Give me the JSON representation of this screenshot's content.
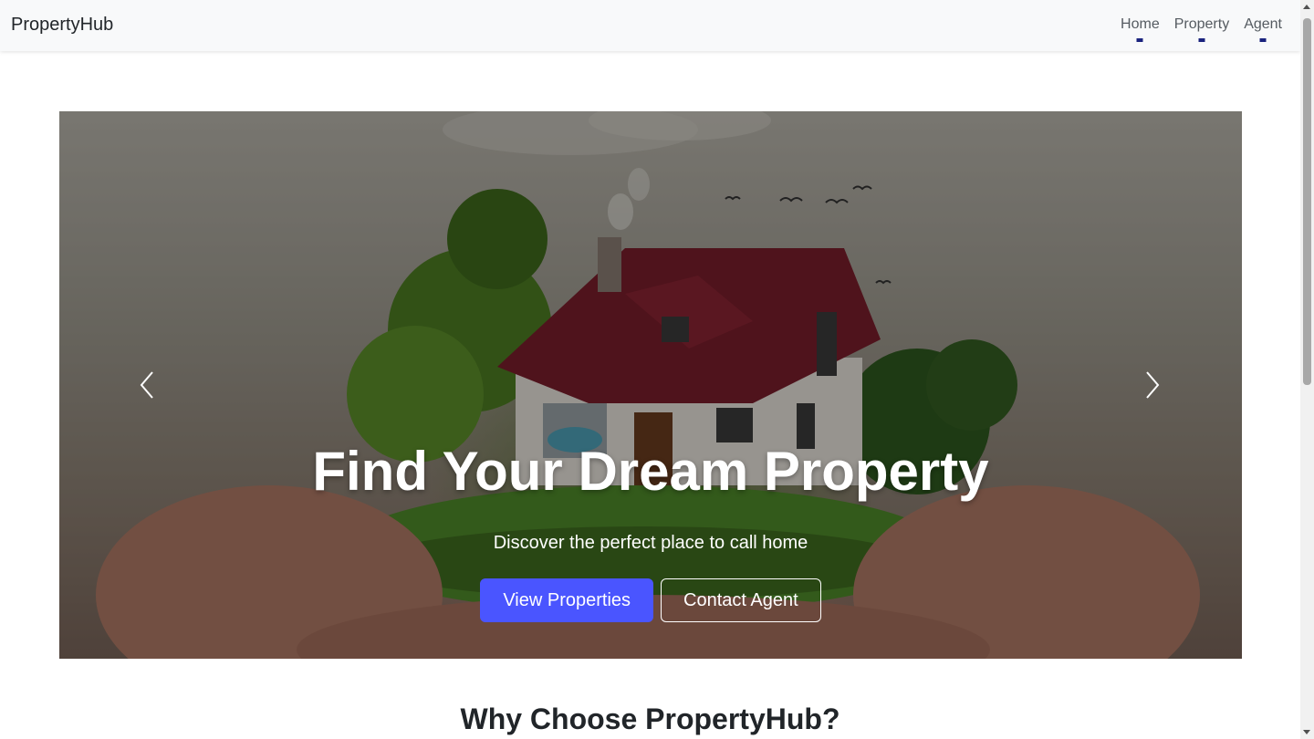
{
  "navbar": {
    "brand": "PropertyHub",
    "links": [
      "Home",
      "Property",
      "Agent"
    ]
  },
  "hero": {
    "title": "Find Your Dream Property",
    "subtitle": "Discover the perfect place to call home",
    "primary_button": "View Properties",
    "secondary_button": "Contact Agent",
    "prev_icon": "chevron-left-icon",
    "next_icon": "chevron-right-icon"
  },
  "section": {
    "title": "Why Choose PropertyHub?"
  },
  "colors": {
    "primary": "#4a55ff",
    "nav_bg": "#f8f9fa",
    "nav_indicator": "#1a237e"
  }
}
